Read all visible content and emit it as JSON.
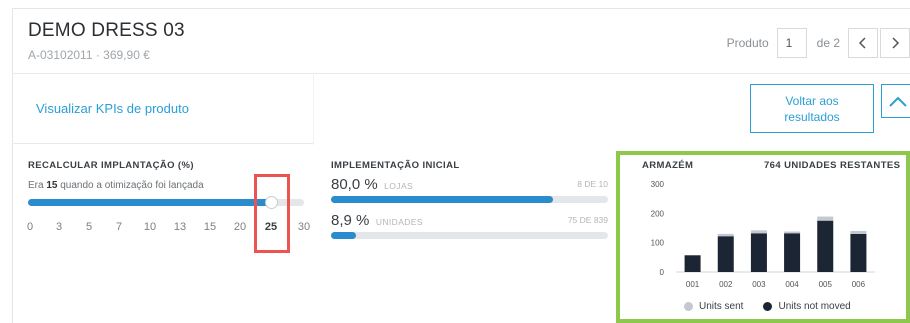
{
  "product": {
    "name": "DEMO DRESS 03",
    "code_price": "A-03102011 · 369,90 €"
  },
  "pager": {
    "label": "Produto",
    "current": "1",
    "of_label": "de 2",
    "prev_icon": "chevron-left-icon",
    "next_icon": "chevron-right-icon"
  },
  "kpi_link": "Visualizar KPIs de produto",
  "back_button": "Voltar aos resultados",
  "collapse_icon": "chevron-up-icon",
  "recalc": {
    "heading": "RECALCULAR IMPLANTAÇÃO (%)",
    "note_prefix": "Era",
    "note_value": "15",
    "note_suffix": "quando a otimização foi lançada",
    "ticks": [
      "0",
      "3",
      "5",
      "7",
      "10",
      "13",
      "15",
      "20",
      "25",
      "30"
    ],
    "selected": "25",
    "slider_fraction": 0.88
  },
  "implementation": {
    "heading": "IMPLEMENTAÇÃO INICIAL",
    "stores": {
      "pct": "80,0 %",
      "unit": "LOJAS",
      "count": "8 DE 10",
      "fraction": 0.8
    },
    "units": {
      "pct": "8,9 %",
      "unit": "UNIDADES",
      "count": "75 DE 839",
      "fraction": 0.089
    }
  },
  "warehouse": {
    "heading": "ARMAZÉM",
    "remaining": "764 UNIDADES RESTANTES"
  },
  "colors": {
    "accent": "#2a9fd6",
    "bar_blue": "#2a8ccc",
    "highlight_red": "#ec5353",
    "highlight_green": "#8cc84b",
    "units_sent": "#c3c9d1",
    "units_not_moved": "#1c2533"
  },
  "chart_data": {
    "type": "bar",
    "stacked": true,
    "categories": [
      "001",
      "002",
      "003",
      "004",
      "005",
      "006"
    ],
    "series": [
      {
        "name": "Units not moved",
        "values": [
          57,
          122,
          132,
          132,
          175,
          130
        ]
      },
      {
        "name": "Units sent",
        "values": [
          0,
          8,
          10,
          6,
          14,
          10
        ]
      }
    ],
    "yticks": [
      "0",
      "100",
      "200",
      "300"
    ],
    "ylim": [
      0,
      300
    ],
    "legend": [
      "Units sent",
      "Units not moved"
    ],
    "legend_position": "bottom"
  }
}
